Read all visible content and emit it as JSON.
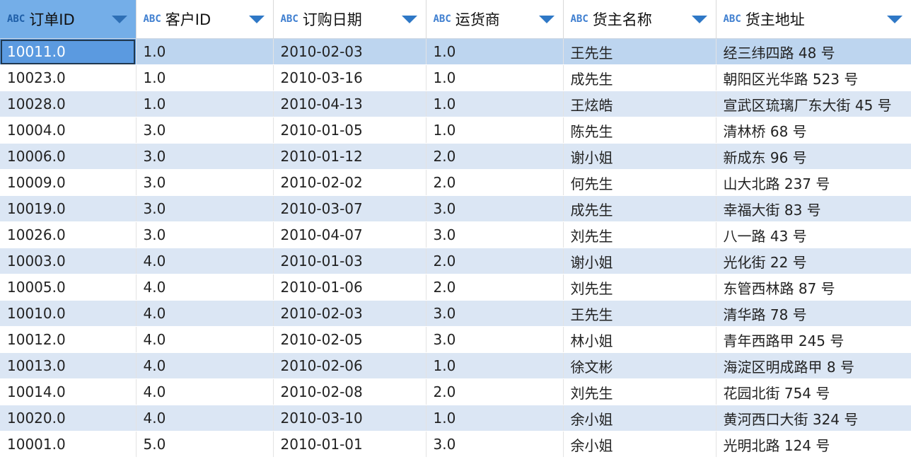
{
  "columns": [
    {
      "type_badge": "ABC",
      "label": "订单ID",
      "sorted": true
    },
    {
      "type_badge": "ABC",
      "label": "客户ID",
      "sorted": false
    },
    {
      "type_badge": "ABC",
      "label": "订购日期",
      "sorted": false
    },
    {
      "type_badge": "ABC",
      "label": "运货商",
      "sorted": false
    },
    {
      "type_badge": "ABC",
      "label": "货主名称",
      "sorted": false
    },
    {
      "type_badge": "ABC",
      "label": "货主地址",
      "sorted": false
    }
  ],
  "rows": [
    [
      "10011.0",
      "1.0",
      "2010-02-03",
      "1.0",
      "王先生",
      "经三纬四路 48 号"
    ],
    [
      "10023.0",
      "1.0",
      "2010-03-16",
      "1.0",
      "成先生",
      "朝阳区光华路 523 号"
    ],
    [
      "10028.0",
      "1.0",
      "2010-04-13",
      "1.0",
      "王炫皓",
      "宣武区琉璃厂东大街 45 号"
    ],
    [
      "10004.0",
      "3.0",
      "2010-01-05",
      "1.0",
      "陈先生",
      "清林桥 68 号"
    ],
    [
      "10006.0",
      "3.0",
      "2010-01-12",
      "2.0",
      "谢小姐",
      "新成东 96 号"
    ],
    [
      "10009.0",
      "3.0",
      "2010-02-02",
      "2.0",
      "何先生",
      "山大北路 237 号"
    ],
    [
      "10019.0",
      "3.0",
      "2010-03-07",
      "3.0",
      "成先生",
      "幸福大街 83 号"
    ],
    [
      "10026.0",
      "3.0",
      "2010-04-07",
      "3.0",
      "刘先生",
      "八一路 43 号"
    ],
    [
      "10003.0",
      "4.0",
      "2010-01-03",
      "2.0",
      "谢小姐",
      "光化街 22 号"
    ],
    [
      "10005.0",
      "4.0",
      "2010-01-06",
      "2.0",
      "刘先生",
      "东管西林路 87 号"
    ],
    [
      "10010.0",
      "4.0",
      "2010-02-03",
      "3.0",
      "王先生",
      "清华路 78 号"
    ],
    [
      "10012.0",
      "4.0",
      "2010-02-05",
      "3.0",
      "林小姐",
      "青年西路甲 245 号"
    ],
    [
      "10013.0",
      "4.0",
      "2010-02-06",
      "1.0",
      "徐文彬",
      "海淀区明成路甲 8 号"
    ],
    [
      "10014.0",
      "4.0",
      "2010-02-08",
      "2.0",
      "刘先生",
      "花园北街 754 号"
    ],
    [
      "10020.0",
      "4.0",
      "2010-03-10",
      "1.0",
      "余小姐",
      "黄河西口大街 324 号"
    ],
    [
      "10001.0",
      "5.0",
      "2010-01-01",
      "3.0",
      "余小姐",
      "光明北路 124 号"
    ]
  ],
  "selected_row": 0,
  "focused_column": 0,
  "colors": {
    "sorted_header": "#74aee8",
    "stripe": "#dbe6f4",
    "selected_row": "#bdd5ef",
    "focused_cell": "#5b9ae0",
    "accent": "#2f78c6"
  }
}
